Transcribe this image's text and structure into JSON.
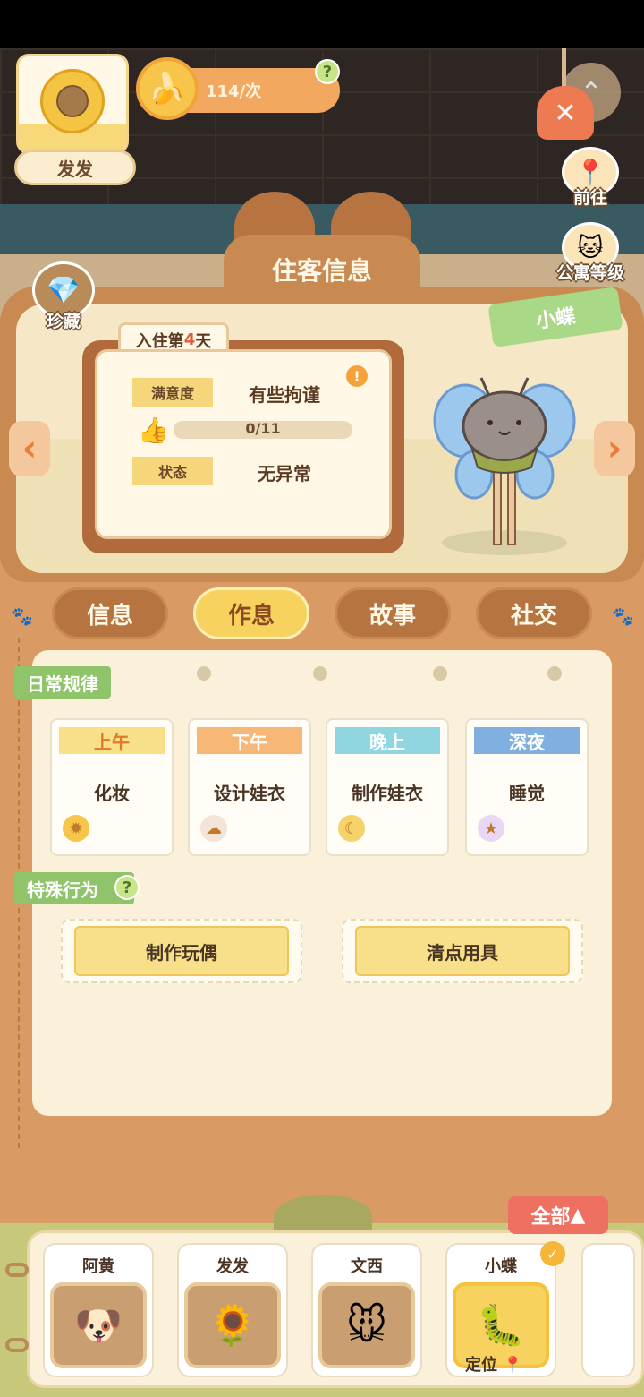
{
  "header": {
    "player_name": "发发",
    "banana_rate": "114/次",
    "help_glyph": "?"
  },
  "side_buttons": {
    "goto_label": "前往",
    "apartment_level_label": "公寓等级",
    "treasure_label": "珍藏"
  },
  "panel": {
    "title": "住客信息",
    "guest_name": "小蝶",
    "days_prefix": "入住第",
    "days_number": "4",
    "days_suffix": "天",
    "satisfaction_label": "满意度",
    "satisfaction_value": "有些拘谨",
    "likes_progress_text": "0/11",
    "likes_progress_fraction": 0,
    "status_label": "状态",
    "status_value": "无异常"
  },
  "tabs": [
    {
      "label": "信息",
      "active": false
    },
    {
      "label": "作息",
      "active": true
    },
    {
      "label": "故事",
      "active": false
    },
    {
      "label": "社交",
      "active": false
    }
  ],
  "routine": {
    "section_title": "日常规律",
    "slots": [
      {
        "period": "上午",
        "activity": "化妆",
        "head_color": "#f8e08a",
        "text_color": "#e07a2a",
        "icon": "sun-icon"
      },
      {
        "period": "下午",
        "activity": "设计娃衣",
        "head_color": "#f7b877",
        "text_color": "#ffffff",
        "icon": "cloud-icon"
      },
      {
        "period": "晚上",
        "activity": "制作娃衣",
        "head_color": "#8fd6e0",
        "text_color": "#ffffff",
        "icon": "moon-icon"
      },
      {
        "period": "深夜",
        "activity": "睡觉",
        "head_color": "#7fb0e0",
        "text_color": "#ffffff",
        "icon": "star-icon"
      }
    ]
  },
  "special": {
    "section_title": "特殊行为",
    "actions": [
      "制作玩偶",
      "清点用具"
    ]
  },
  "roster": {
    "filter_label": "全部",
    "residents": [
      {
        "name": "阿黄",
        "selected": false
      },
      {
        "name": "发发",
        "selected": false
      },
      {
        "name": "文西",
        "selected": false
      },
      {
        "name": "小蝶",
        "selected": true
      }
    ],
    "locate_label": "定位"
  }
}
